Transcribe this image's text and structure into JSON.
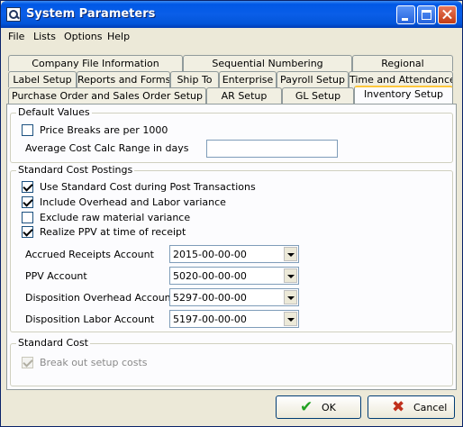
{
  "window": {
    "title": "System Parameters"
  },
  "menu": [
    "File",
    "Lists",
    "Options",
    "Help"
  ],
  "tabs": {
    "row1": [
      "Company File Information",
      "Sequential Numbering",
      "Regional"
    ],
    "row2": [
      "Label Setup",
      "Reports and Forms",
      "Ship To",
      "Enterprise",
      "Payroll Setup",
      "Time and Attendance"
    ],
    "row3": [
      "Purchase Order and Sales Order Setup",
      "AR Setup",
      "GL Setup",
      "Inventory Setup"
    ],
    "active": "Inventory Setup"
  },
  "default_values": {
    "title": "Default Values",
    "price_breaks": {
      "label": "Price Breaks are per 1000",
      "checked": false
    },
    "avg_cost": {
      "label": "Average Cost Calc Range in days",
      "value": ""
    }
  },
  "standard_cost_postings": {
    "title": "Standard Cost Postings",
    "checkboxes": [
      {
        "label": "Use Standard Cost during Post Transactions",
        "checked": true
      },
      {
        "label": "Include Overhead and Labor variance",
        "checked": true
      },
      {
        "label": "Exclude raw material variance",
        "checked": false
      },
      {
        "label": "Realize PPV at time of receipt",
        "checked": true
      }
    ],
    "accounts": [
      {
        "label": "Accrued Receipts Account",
        "value": "2015-00-00-00"
      },
      {
        "label": "PPV Account",
        "value": "5020-00-00-00"
      },
      {
        "label": "Disposition Overhead Account",
        "value": "5297-00-00-00"
      },
      {
        "label": "Disposition Labor Account",
        "value": "5197-00-00-00"
      }
    ]
  },
  "standard_cost": {
    "title": "Standard Cost",
    "break_out": {
      "label": "Break out setup costs",
      "checked": true,
      "enabled": false
    }
  },
  "buttons": {
    "ok": {
      "label": "OK",
      "icon": "check-icon",
      "color": "#21a121"
    },
    "cancel": {
      "label": "Cancel",
      "icon": "x-icon",
      "color": "#c0301c"
    }
  }
}
